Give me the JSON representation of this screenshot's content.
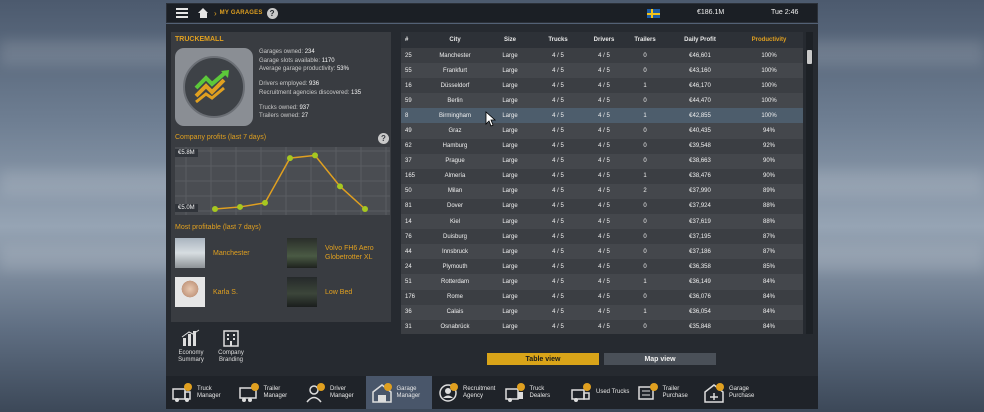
{
  "topbar": {
    "breadcrumb": "MY GARAGES",
    "help": "?",
    "money": "€186.1M",
    "time": "Tue 2:46"
  },
  "company": {
    "name": "TRUCKEMALL",
    "stats": [
      {
        "label": "Garages owned: ",
        "value": "234"
      },
      {
        "label": "Garage slots available: ",
        "value": "1170"
      },
      {
        "label": "Average garage productivity: ",
        "value": "53%"
      },
      {
        "label": "Drivers employed: ",
        "value": "936"
      },
      {
        "label": "Recruitment agencies discovered: ",
        "value": "135"
      },
      {
        "label": "Trucks owned: ",
        "value": "937"
      },
      {
        "label": "Trailers owned: ",
        "value": "27"
      }
    ]
  },
  "profits": {
    "title": "Company profits (last 7 days)",
    "help": "?"
  },
  "chart_data": {
    "type": "line",
    "title": "Company profits (last 7 days)",
    "tick_labels": [
      "€5.8M",
      "€5.0M"
    ],
    "ylim": [
      5.0,
      5.8
    ],
    "y_values": [
      5.0,
      5.03,
      5.09,
      5.74,
      5.78,
      5.33,
      5.0
    ],
    "colors": {
      "line": "#e0a020",
      "point": "#a6c820"
    },
    "grid": true
  },
  "most_profitable": {
    "title": "Most profitable (last 7 days)",
    "items": [
      {
        "label": "Manchester"
      },
      {
        "label": "Volvo FH6 Aero Globetrotter XL"
      },
      {
        "label": "Karla S."
      },
      {
        "label": "Low Bed"
      }
    ]
  },
  "bottom_left": {
    "economy": "Economy Summary",
    "branding": "Company Branding"
  },
  "table": {
    "headers": [
      "#",
      "City",
      "Size",
      "Trucks",
      "Drivers",
      "Trailers",
      "Daily Profit",
      "Productivity"
    ],
    "rows": [
      [
        "25",
        "Manchester",
        "Large",
        "4 / 5",
        "4 / 5",
        "0",
        "€46,601",
        "100%"
      ],
      [
        "55",
        "Frankfurt",
        "Large",
        "4 / 5",
        "4 / 5",
        "0",
        "€43,160",
        "100%"
      ],
      [
        "16",
        "Düsseldorf",
        "Large",
        "4 / 5",
        "4 / 5",
        "1",
        "€46,170",
        "100%"
      ],
      [
        "59",
        "Berlin",
        "Large",
        "4 / 5",
        "4 / 5",
        "0",
        "€44,470",
        "100%"
      ],
      [
        "8",
        "Birmingham",
        "Large",
        "4 / 5",
        "4 / 5",
        "1",
        "€42,855",
        "100%"
      ],
      [
        "49",
        "Graz",
        "Large",
        "4 / 5",
        "4 / 5",
        "0",
        "€40,435",
        "94%"
      ],
      [
        "62",
        "Hamburg",
        "Large",
        "4 / 5",
        "4 / 5",
        "0",
        "€39,548",
        "92%"
      ],
      [
        "37",
        "Prague",
        "Large",
        "4 / 5",
        "4 / 5",
        "0",
        "€38,663",
        "90%"
      ],
      [
        "165",
        "Almería",
        "Large",
        "4 / 5",
        "4 / 5",
        "1",
        "€38,476",
        "90%"
      ],
      [
        "50",
        "Milan",
        "Large",
        "4 / 5",
        "4 / 5",
        "2",
        "€37,990",
        "89%"
      ],
      [
        "81",
        "Dover",
        "Large",
        "4 / 5",
        "4 / 5",
        "0",
        "€37,924",
        "88%"
      ],
      [
        "14",
        "Kiel",
        "Large",
        "4 / 5",
        "4 / 5",
        "0",
        "€37,619",
        "88%"
      ],
      [
        "76",
        "Duisburg",
        "Large",
        "4 / 5",
        "4 / 5",
        "0",
        "€37,195",
        "87%"
      ],
      [
        "44",
        "Innsbruck",
        "Large",
        "4 / 5",
        "4 / 5",
        "0",
        "€37,186",
        "87%"
      ],
      [
        "24",
        "Plymouth",
        "Large",
        "4 / 5",
        "4 / 5",
        "0",
        "€36,358",
        "85%"
      ],
      [
        "51",
        "Rotterdam",
        "Large",
        "4 / 5",
        "4 / 5",
        "1",
        "€36,149",
        "84%"
      ],
      [
        "176",
        "Rome",
        "Large",
        "4 / 5",
        "4 / 5",
        "0",
        "€36,076",
        "84%"
      ],
      [
        "36",
        "Calais",
        "Large",
        "4 / 5",
        "4 / 5",
        "1",
        "€36,054",
        "84%"
      ],
      [
        "31",
        "Osnabrück",
        "Large",
        "4 / 5",
        "4 / 5",
        "0",
        "€35,848",
        "84%"
      ]
    ],
    "selected_index": 4
  },
  "view_buttons": {
    "table": "Table view",
    "map": "Map view"
  },
  "toolbar": [
    {
      "name": "truck-manager",
      "label": "Truck\nManager"
    },
    {
      "name": "trailer-manager",
      "label": "Trailer\nManager"
    },
    {
      "name": "driver-manager",
      "label": "Driver\nManager"
    },
    {
      "name": "garage-manager",
      "label": "Garage\nManager"
    },
    {
      "name": "recruitment-agency",
      "label": "Recruitment\nAgency"
    },
    {
      "name": "truck-dealers",
      "label": "Truck\nDealers"
    },
    {
      "name": "used-trucks",
      "label": "Used Trucks"
    },
    {
      "name": "trailer-purchase",
      "label": "Trailer\nPurchase"
    },
    {
      "name": "garage-purchase",
      "label": "Garage\nPurchase"
    }
  ],
  "toolbar_active_index": 3
}
